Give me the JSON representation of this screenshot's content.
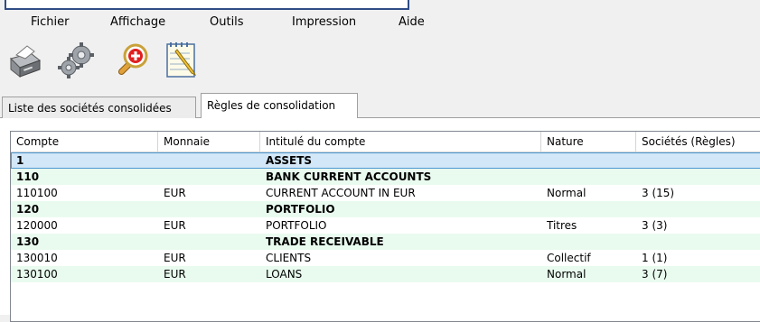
{
  "menu": [
    "Fichier",
    "Affichage",
    "Outils",
    "Impression",
    "Aide"
  ],
  "toolbar": {
    "icons": [
      "printer-icon",
      "gears-icon",
      "zoom-add-icon",
      "notepad-icon"
    ]
  },
  "tabs": [
    {
      "label": "Liste des sociétés consolidées",
      "active": false
    },
    {
      "label": "Règles de consolidation",
      "active": true
    }
  ],
  "table": {
    "columns": [
      "Compte",
      "Monnaie",
      "Intitulé du compte",
      "Nature",
      "Sociétés  (Règles)"
    ],
    "rows": [
      {
        "compte": "1",
        "monnaie": "",
        "intitule": "ASSETS",
        "nature": "",
        "societes": "",
        "bold": true,
        "selected": true
      },
      {
        "compte": "110",
        "monnaie": "",
        "intitule": "BANK CURRENT ACCOUNTS",
        "nature": "",
        "societes": "",
        "bold": true
      },
      {
        "compte": "110100",
        "monnaie": "EUR",
        "intitule": "CURRENT ACCOUNT IN EUR",
        "nature": "Normal",
        "societes": "3  (15)",
        "bold": false
      },
      {
        "compte": "120",
        "monnaie": "",
        "intitule": "PORTFOLIO",
        "nature": "",
        "societes": "",
        "bold": true
      },
      {
        "compte": "120000",
        "monnaie": "EUR",
        "intitule": "PORTFOLIO",
        "nature": "Titres",
        "societes": "3  (3)",
        "bold": false
      },
      {
        "compte": "130",
        "monnaie": "",
        "intitule": "TRADE RECEIVABLE",
        "nature": "",
        "societes": "",
        "bold": true
      },
      {
        "compte": "130010",
        "monnaie": "EUR",
        "intitule": "CLIENTS",
        "nature": "Collectif",
        "societes": "1  (1)",
        "bold": false
      },
      {
        "compte": "130100",
        "monnaie": "EUR",
        "intitule": "LOANS",
        "nature": "Normal",
        "societes": "3  (7)",
        "bold": false
      }
    ]
  },
  "colors": {
    "alt_row": "#e9fbef",
    "selected_row": "#d2e7f7",
    "selected_border": "#4d97d0",
    "frame": "#2f4d85"
  }
}
